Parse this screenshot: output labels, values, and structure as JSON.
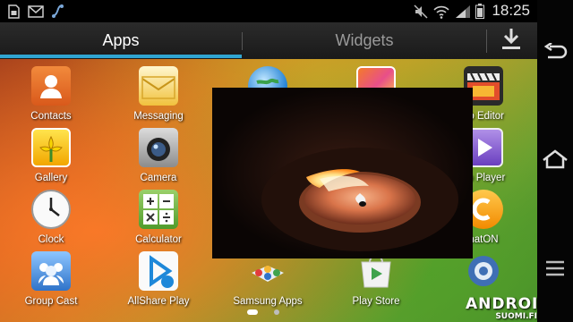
{
  "status_bar": {
    "time": "18:25",
    "icons": [
      "sim-card-icon",
      "gmail-icon",
      "usb-debug-icon",
      "mute-icon",
      "wifi-icon",
      "signal-icon",
      "battery-icon"
    ]
  },
  "tabs": [
    {
      "label": "Apps",
      "active": true
    },
    {
      "label": "Widgets",
      "active": false
    }
  ],
  "apps": [
    {
      "label": "Contacts",
      "icon": "contacts-icon"
    },
    {
      "label": "Messaging",
      "icon": "messaging-icon"
    },
    {
      "label": "",
      "icon": "internet-icon"
    },
    {
      "label": "",
      "icon": "photo-editor-icon"
    },
    {
      "label": "eo Editor",
      "icon": "video-editor-icon"
    },
    {
      "label": "Gallery",
      "icon": "gallery-icon"
    },
    {
      "label": "Camera",
      "icon": "camera-icon"
    },
    {
      "label": "eo Player",
      "icon": "video-player-icon"
    },
    {
      "label": "Clock",
      "icon": "clock-icon"
    },
    {
      "label": "Calculator",
      "icon": "calculator-icon"
    },
    {
      "label": "hatON",
      "icon": "chaton-icon"
    },
    {
      "label": "Group Cast",
      "icon": "group-cast-icon"
    },
    {
      "label": "AllShare Play",
      "icon": "allshare-play-icon"
    },
    {
      "label": "Samsung Apps",
      "icon": "samsung-apps-icon"
    },
    {
      "label": "Play Store",
      "icon": "play-store-icon"
    },
    {
      "label": "",
      "icon": "settings-icon"
    }
  ],
  "page_indicator": {
    "pages": 2,
    "current": 1
  },
  "watermark": {
    "line1": "ANDROID",
    "line2": "SUOMI.FI"
  },
  "colors": {
    "accent": "#33b5e5",
    "tab_inactive": "#9a9a9a"
  }
}
